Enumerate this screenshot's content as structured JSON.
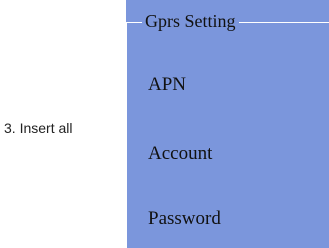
{
  "instruction": {
    "text": "3. Insert all"
  },
  "gprs_panel": {
    "title": "Gprs Setting",
    "background_color": "#7b96dc",
    "fields": [
      {
        "label": "APN"
      },
      {
        "label": "Account"
      },
      {
        "label": "Password"
      }
    ]
  }
}
